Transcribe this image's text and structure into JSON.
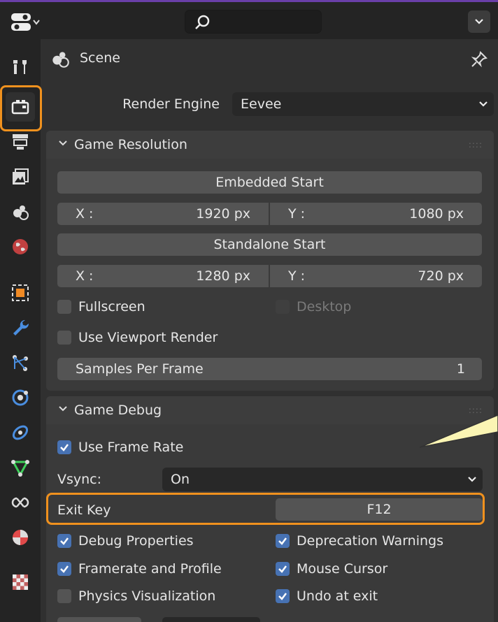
{
  "header": {
    "scene_label": "Scene"
  },
  "render_engine": {
    "label": "Render Engine",
    "value": "Eevee"
  },
  "game_resolution": {
    "title": "Game Resolution",
    "embedded_start_label": "Embedded Start",
    "embedded": {
      "x_label": "X :",
      "x_value": "1920 px",
      "y_label": "Y :",
      "y_value": "1080 px"
    },
    "standalone_start_label": "Standalone Start",
    "standalone": {
      "x_label": "X :",
      "x_value": "1280 px",
      "y_label": "Y :",
      "y_value": "720 px"
    },
    "fullscreen_label": "Fullscreen",
    "fullscreen_checked": false,
    "desktop_label": "Desktop",
    "desktop_checked": false,
    "viewport_render_label": "Use Viewport Render",
    "viewport_render_checked": false,
    "samples_label": "Samples Per Frame",
    "samples_value": "1"
  },
  "game_debug": {
    "title": "Game Debug",
    "use_frame_rate_label": "Use Frame Rate",
    "use_frame_rate_checked": true,
    "vsync_label": "Vsync:",
    "vsync_value": "On",
    "exit_key_label": "Exit Key",
    "exit_key_value": "F12",
    "options": [
      {
        "label": "Debug Properties",
        "checked": true
      },
      {
        "label": "Deprecation Warnings",
        "checked": true
      },
      {
        "label": "Framerate and Profile",
        "checked": true
      },
      {
        "label": "Mouse Cursor",
        "checked": true
      },
      {
        "label": "Physics Visualization",
        "checked": false
      },
      {
        "label": "Undo at exit",
        "checked": true
      }
    ]
  },
  "colors": {
    "accent_highlight": "#f0911e",
    "checkbox_on": "#4772b3",
    "window_top_border": "#6a3fa8",
    "callout_fill": "#fbf5b4"
  }
}
